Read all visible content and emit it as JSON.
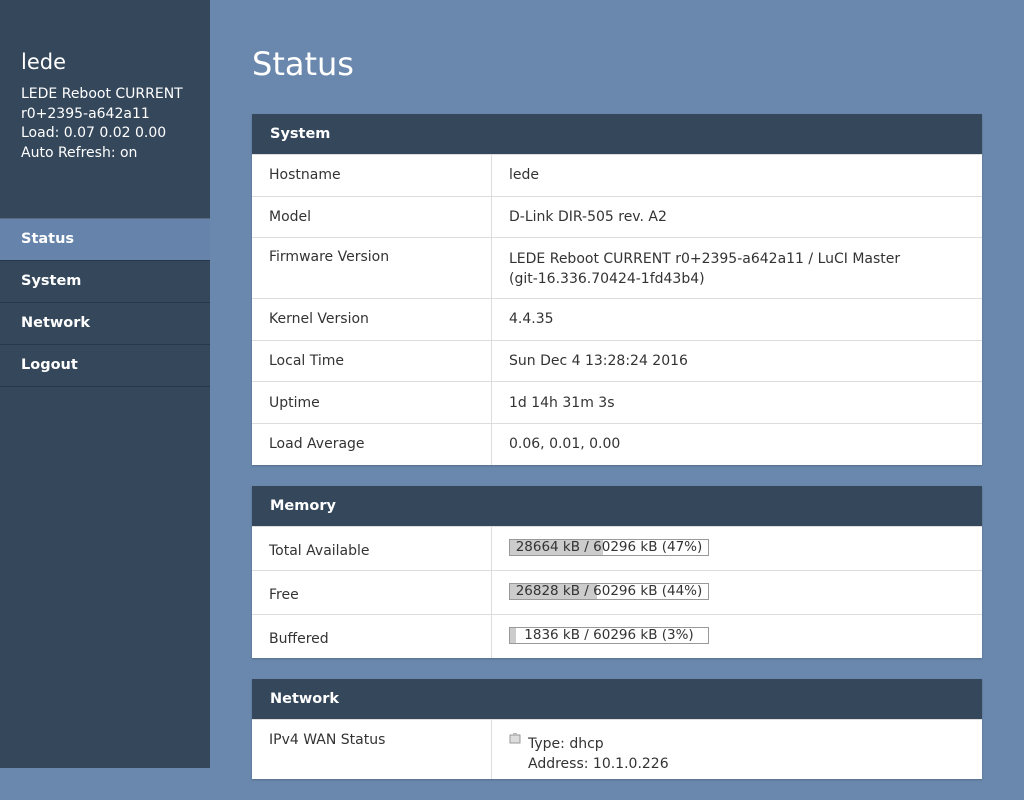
{
  "sidebar": {
    "hostname": "lede",
    "firmware_line1": "LEDE Reboot CURRENT",
    "firmware_line2": "r0+2395-a642a11",
    "load": "Load: 0.07 0.02 0.00",
    "auto_refresh": "Auto Refresh: on",
    "nav": [
      {
        "label": "Status",
        "active": true
      },
      {
        "label": "System",
        "active": false
      },
      {
        "label": "Network",
        "active": false
      },
      {
        "label": "Logout",
        "active": false
      }
    ]
  },
  "page": {
    "title": "Status"
  },
  "system": {
    "heading": "System",
    "rows": [
      {
        "label": "Hostname",
        "value": "lede"
      },
      {
        "label": "Model",
        "value": "D-Link DIR-505 rev. A2"
      },
      {
        "label": "Firmware Version",
        "value1": "LEDE Reboot CURRENT r0+2395-a642a11 / LuCI Master",
        "value2": "(git-16.336.70424-1fd43b4)"
      },
      {
        "label": "Kernel Version",
        "value": "4.4.35"
      },
      {
        "label": "Local Time",
        "value": "Sun Dec 4 13:28:24 2016"
      },
      {
        "label": "Uptime",
        "value": "1d 14h 31m 3s"
      },
      {
        "label": "Load Average",
        "value": "0.06, 0.01, 0.00"
      }
    ]
  },
  "memory": {
    "heading": "Memory",
    "rows": [
      {
        "label": "Total Available",
        "text": "28664 kB / 60296 kB (47%)",
        "percent": 47
      },
      {
        "label": "Free",
        "text": "26828 kB / 60296 kB (44%)",
        "percent": 44
      },
      {
        "label": "Buffered",
        "text": "1836 kB / 60296 kB (3%)",
        "percent": 3
      }
    ]
  },
  "network": {
    "heading": "Network",
    "rows": [
      {
        "label": "IPv4 WAN Status",
        "type": "Type: dhcp",
        "address": "Address: 10.1.0.226",
        "icon": "network-port-icon"
      }
    ]
  }
}
